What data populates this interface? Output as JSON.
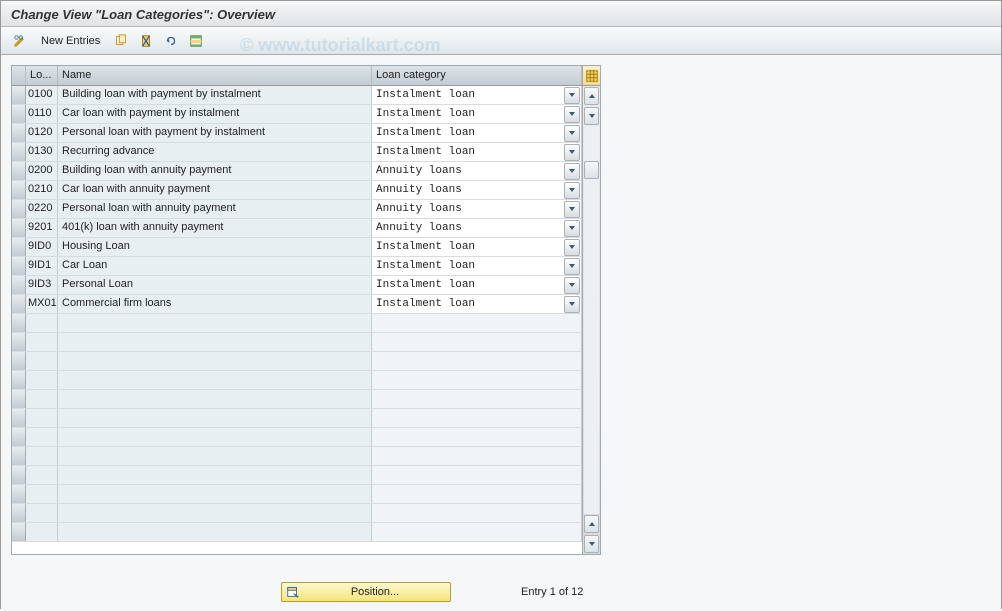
{
  "title": "Change View \"Loan Categories\": Overview",
  "toolbar": {
    "new_entries_label": "New Entries"
  },
  "watermark": "© www.tutorialkart.com",
  "grid": {
    "headers": {
      "code": "Lo...",
      "name": "Name",
      "category": "Loan category"
    },
    "rows": [
      {
        "code": "0100",
        "name": "Building loan with payment by instalment",
        "category": "Instalment loan"
      },
      {
        "code": "0110",
        "name": "Car loan with payment by instalment",
        "category": "Instalment loan"
      },
      {
        "code": "0120",
        "name": "Personal loan with payment by instalment",
        "category": "Instalment loan"
      },
      {
        "code": "0130",
        "name": "Recurring advance",
        "category": "Instalment loan"
      },
      {
        "code": "0200",
        "name": "Building loan with annuity payment",
        "category": "Annuity loans"
      },
      {
        "code": "0210",
        "name": "Car loan with annuity payment",
        "category": "Annuity loans"
      },
      {
        "code": "0220",
        "name": "Personal loan with annuity payment",
        "category": "Annuity loans"
      },
      {
        "code": "9201",
        "name": "401(k) loan with annuity payment",
        "category": "Annuity loans"
      },
      {
        "code": "9ID0",
        "name": "Housing Loan",
        "category": "Instalment loan"
      },
      {
        "code": "9ID1",
        "name": "Car Loan",
        "category": "Instalment loan"
      },
      {
        "code": "9ID3",
        "name": "Personal Loan",
        "category": "Instalment loan"
      },
      {
        "code": "MX01",
        "name": "Commercial firm loans",
        "category": "Instalment loan"
      }
    ],
    "empty_row_count": 12
  },
  "footer": {
    "position_label": "Position...",
    "entry_text": "Entry 1 of 12"
  }
}
